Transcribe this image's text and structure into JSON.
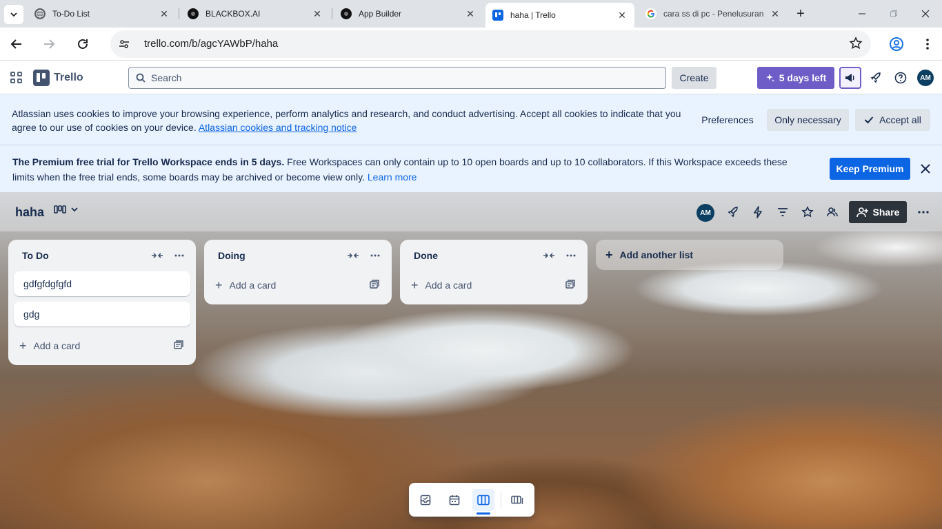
{
  "browser": {
    "tabs": [
      {
        "title": "To-Do List"
      },
      {
        "title": "BLACKBOX.AI"
      },
      {
        "title": "App Builder"
      },
      {
        "title": "haha | Trello"
      },
      {
        "title": "cara ss di pc - Penelusuran"
      }
    ],
    "url": "trello.com/b/agcYAWbP/haha"
  },
  "header": {
    "app_name": "Trello",
    "search_placeholder": "Search",
    "create_label": "Create",
    "trial_label": "5 days left",
    "avatar_initials": "AM"
  },
  "cookie_banner": {
    "message": "Atlassian uses cookies to improve your browsing experience, perform analytics and research, and conduct advertising. Accept all cookies to indicate that you agree to our use of cookies on your device.",
    "link": "Atlassian cookies and tracking notice",
    "preferences_label": "Preferences",
    "only_necessary_label": "Only necessary",
    "accept_all_label": "Accept all"
  },
  "premium_banner": {
    "bold_text": "The Premium free trial for Trello Workspace ends in 5 days.",
    "text": "Free Workspaces can only contain up to 10 open boards and up to 10 collaborators. If this Workspace exceeds these limits when the free trial ends, some boards may be archived or become view only.",
    "link": "Learn more",
    "keep_label": "Keep Premium"
  },
  "board": {
    "title": "haha",
    "member_initials": "AM",
    "share_label": "Share",
    "lists": [
      {
        "title": "To Do",
        "cards": [
          "gdfgfdgfgfd",
          "gdg"
        ],
        "add_label": "Add a card"
      },
      {
        "title": "Doing",
        "cards": [],
        "add_label": "Add a card"
      },
      {
        "title": "Done",
        "cards": [],
        "add_label": "Add a card"
      }
    ],
    "add_list_label": "Add another list"
  },
  "colors": {
    "trello_blue": "#0c66e4",
    "trial_purple": "#6e5dc6",
    "banner_bg": "#e9f2ff"
  }
}
